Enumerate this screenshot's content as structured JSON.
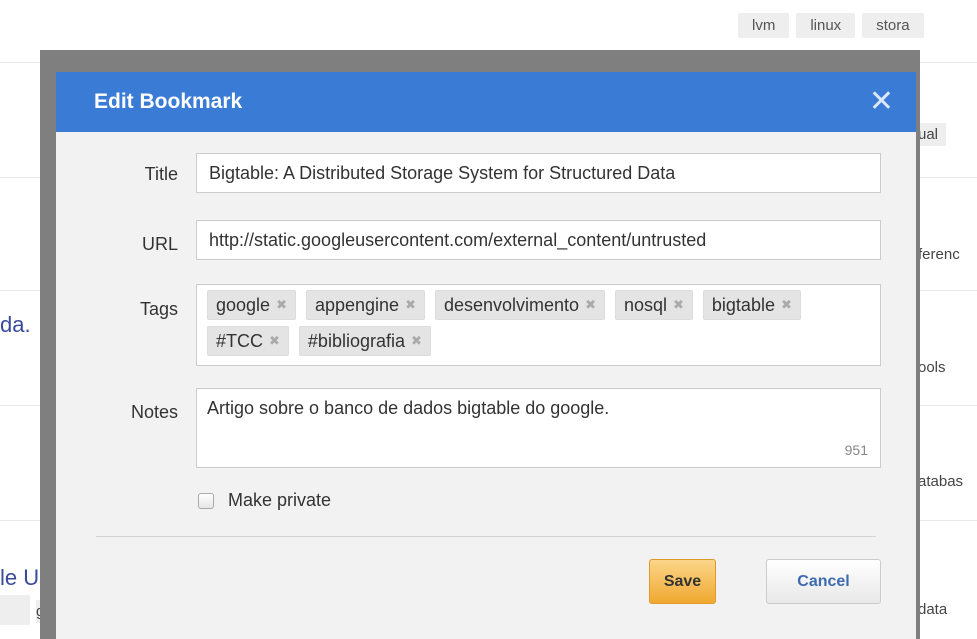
{
  "background": {
    "top_tags": [
      "lvm",
      "linux",
      "stora"
    ],
    "side_items": [
      "ual",
      "ferenc",
      "ools",
      "atabas",
      "data"
    ],
    "left_links": [
      "da.",
      "le U"
    ],
    "left_bottom": "g"
  },
  "modal": {
    "title": "Edit Bookmark",
    "close_glyph": "✕",
    "fields": {
      "title_label": "Title",
      "title_value": "Bigtable: A Distributed Storage System for Structured Data",
      "url_label": "URL",
      "url_value": "http://static.googleusercontent.com/external_content/untrusted",
      "tags_label": "Tags",
      "tags": [
        "google",
        "appengine",
        "desenvolvimento",
        "nosql",
        "bigtable",
        "#TCC",
        "#bibliografia"
      ],
      "tag_remove_glyph": "✖",
      "notes_label": "Notes",
      "notes_value": "Artigo sobre o banco de dados bigtable do google.",
      "notes_remaining": "951"
    },
    "private_label": "Make private",
    "save_label": "Save",
    "cancel_label": "Cancel"
  },
  "colors": {
    "header_blue": "#3a7bd5",
    "save_orange": "#f0a830",
    "cancel_text": "#3e6bb0"
  }
}
